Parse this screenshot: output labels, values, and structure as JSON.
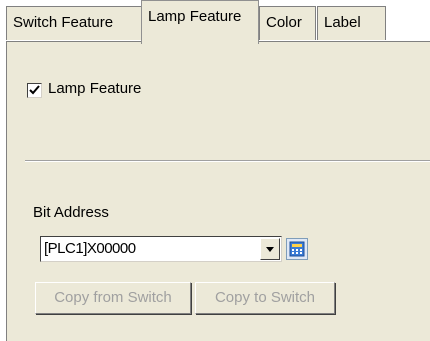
{
  "tabs": [
    {
      "label": "Switch Feature",
      "active": false
    },
    {
      "label": "Lamp Feature",
      "active": true
    },
    {
      "label": "Color",
      "active": false
    },
    {
      "label": "Label",
      "active": false
    }
  ],
  "lamp": {
    "checkbox_label": "Lamp Feature",
    "checked": true
  },
  "bit_address": {
    "label": "Bit Address",
    "value": "[PLC1]X00000"
  },
  "buttons": {
    "copy_from": "Copy from Switch",
    "copy_to": "Copy to Switch"
  },
  "icons": {
    "check": "checkmark-icon",
    "dropdown": "chevron-down-icon",
    "address_input": "keypad-icon"
  }
}
